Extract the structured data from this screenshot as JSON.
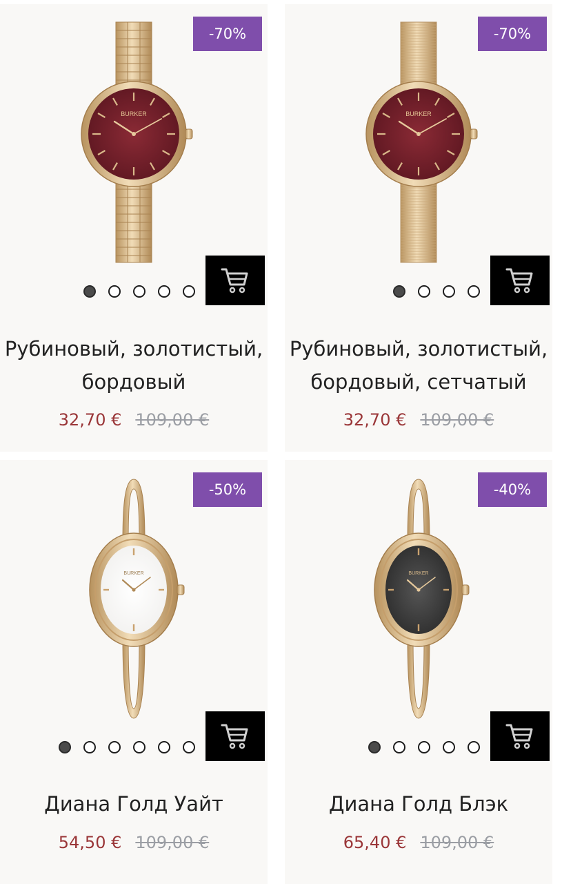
{
  "products": [
    {
      "discount": "-70%",
      "title_lines": [
        "Рубиновый, золотистый,",
        "бордовый"
      ],
      "price_sale": "32,70 €",
      "price_old": "109,00 €",
      "image": {
        "strap": "bracelet-links",
        "case": "round",
        "dial_color": "#5b1620",
        "brand": "BURKER"
      },
      "carousel": {
        "count": 5,
        "active_index": 0
      }
    },
    {
      "discount": "-70%",
      "title_lines": [
        "Рубиновый, золотистый,",
        "бордовый, сетчатый"
      ],
      "price_sale": "32,70 €",
      "price_old": "109,00 €",
      "image": {
        "strap": "mesh",
        "case": "round",
        "dial_color": "#5b1620",
        "brand": "BURKER"
      },
      "carousel": {
        "count": 4,
        "active_index": 0
      }
    },
    {
      "discount": "-50%",
      "title_lines": [
        "Диана Голд Уайт"
      ],
      "price_sale": "54,50 €",
      "price_old": "109,00 €",
      "image": {
        "strap": "bangle",
        "case": "oval",
        "dial_color": "#f1f0ee",
        "brand": "BURKER"
      },
      "carousel": {
        "count": 6,
        "active_index": 0
      }
    },
    {
      "discount": "-40%",
      "title_lines": [
        "Диана Голд Блэк"
      ],
      "price_sale": "65,40 €",
      "price_old": "109,00 €",
      "image": {
        "strap": "bangle",
        "case": "oval",
        "dial_color": "#2b2b2b",
        "brand": "BURKER"
      },
      "carousel": {
        "count": 5,
        "active_index": 0
      }
    }
  ],
  "icons": {
    "cart": "shopping-cart-icon"
  },
  "colors": {
    "badge": "#7f4eab",
    "sale_price": "#9a3638",
    "old_price": "#9b9ea4",
    "cart_button": "#000000",
    "gold": "#d9b88a"
  }
}
